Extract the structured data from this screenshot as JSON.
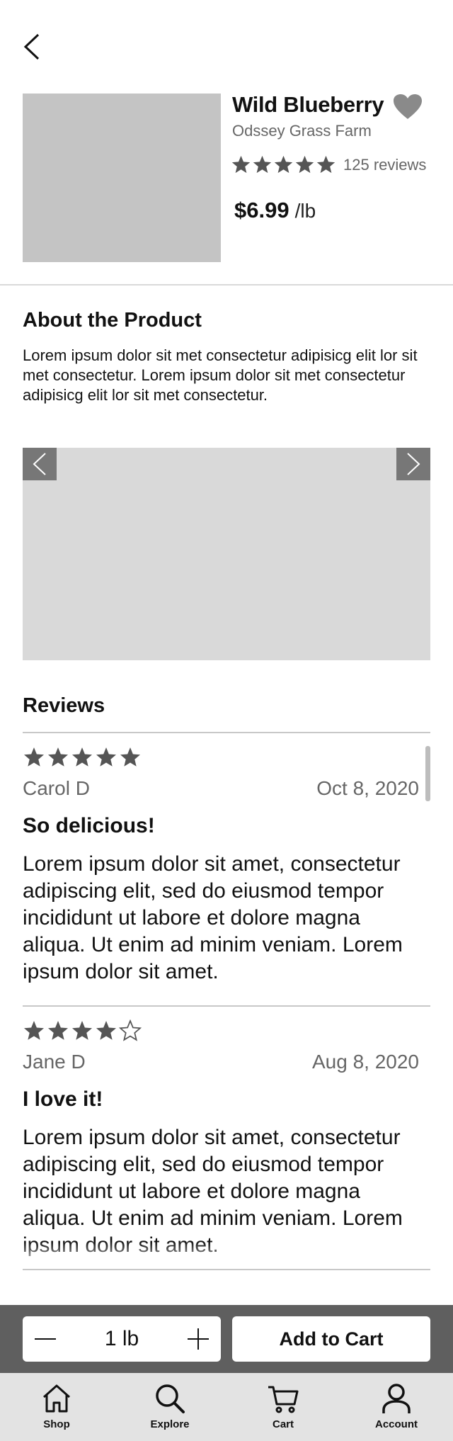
{
  "header": {
    "back_icon": "chevron-left-icon"
  },
  "product": {
    "name": "Wild Blueberry",
    "farm": "Odssey Grass Farm",
    "rating": 5,
    "review_count_text": "125 reviews",
    "price": "$6.99",
    "unit": "/lb",
    "favorite_icon": "heart-icon"
  },
  "about": {
    "title": "About the Product",
    "text": "Lorem ipsum dolor sit met consectetur adipisicg elit lor sit met consectetur. Lorem ipsum dolor sit met consectetur adipisicg elit lor sit met consectetur."
  },
  "carousel": {
    "prev_icon": "chevron-left-icon",
    "next_icon": "chevron-right-icon"
  },
  "reviews": {
    "title": "Reviews",
    "items": [
      {
        "rating": 5,
        "author": "Carol D",
        "date": "Oct 8, 2020",
        "title": "So delicious!",
        "body": "Lorem ipsum dolor sit amet, consectetur adipiscing elit, sed do eiusmod tempor incididunt ut labore et dolore magna aliqua. Ut enim ad minim veniam. Lorem ipsum dolor sit amet."
      },
      {
        "rating": 4,
        "author": "Jane D",
        "date": "Aug 8, 2020",
        "title": "I love it!",
        "body": "Lorem ipsum dolor sit amet, consectetur adipiscing elit, sed do eiusmod tempor incididunt ut labore et dolore magna aliqua. Ut enim ad minim veniam. Lorem ipsum dolor sit amet."
      }
    ]
  },
  "cart": {
    "quantity": "1 lb",
    "add_label": "Add to Cart"
  },
  "tabbar": {
    "items": [
      {
        "label": "Shop",
        "icon": "home-icon"
      },
      {
        "label": "Explore",
        "icon": "search-icon"
      },
      {
        "label": "Cart",
        "icon": "cart-icon"
      },
      {
        "label": "Account",
        "icon": "account-icon"
      }
    ]
  },
  "colors": {
    "star": "#555555",
    "heart": "#8a8a8a",
    "image_placeholder": "#c4c4c4",
    "carousel_bg": "#d9d9d9",
    "cart_bar": "#5f5f5f",
    "tabbar_bg": "#e3e3e3"
  }
}
